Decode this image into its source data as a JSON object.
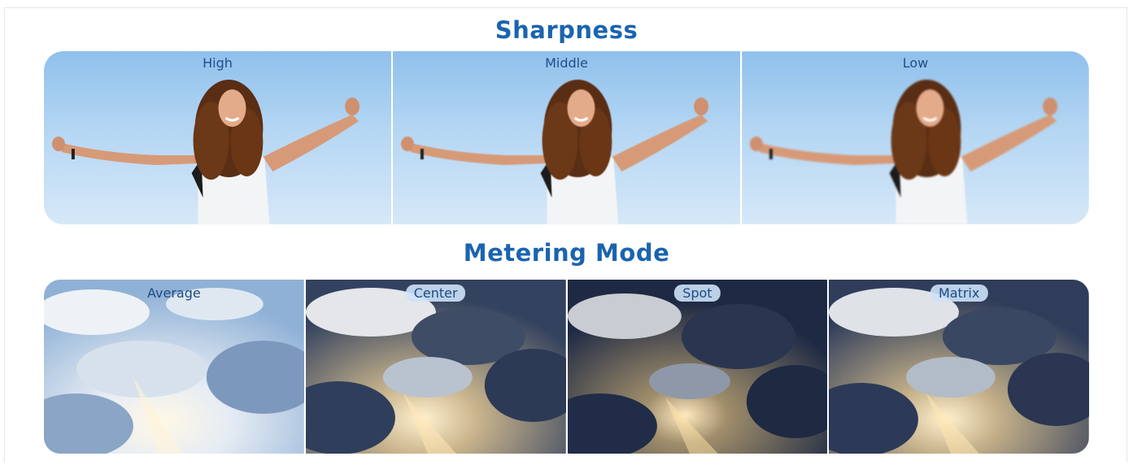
{
  "sharpness": {
    "title": "Sharpness",
    "panels": [
      {
        "label": "High"
      },
      {
        "label": "Middle"
      },
      {
        "label": "Low"
      }
    ]
  },
  "metering": {
    "title": "Metering Mode",
    "panels": [
      {
        "label": "Average"
      },
      {
        "label": "Center"
      },
      {
        "label": "Spot"
      },
      {
        "label": "Matrix"
      }
    ]
  },
  "colors": {
    "title": "#1b64ae",
    "sky_top": "#8fc0ec",
    "sky_bottom": "#d6e8f8"
  }
}
